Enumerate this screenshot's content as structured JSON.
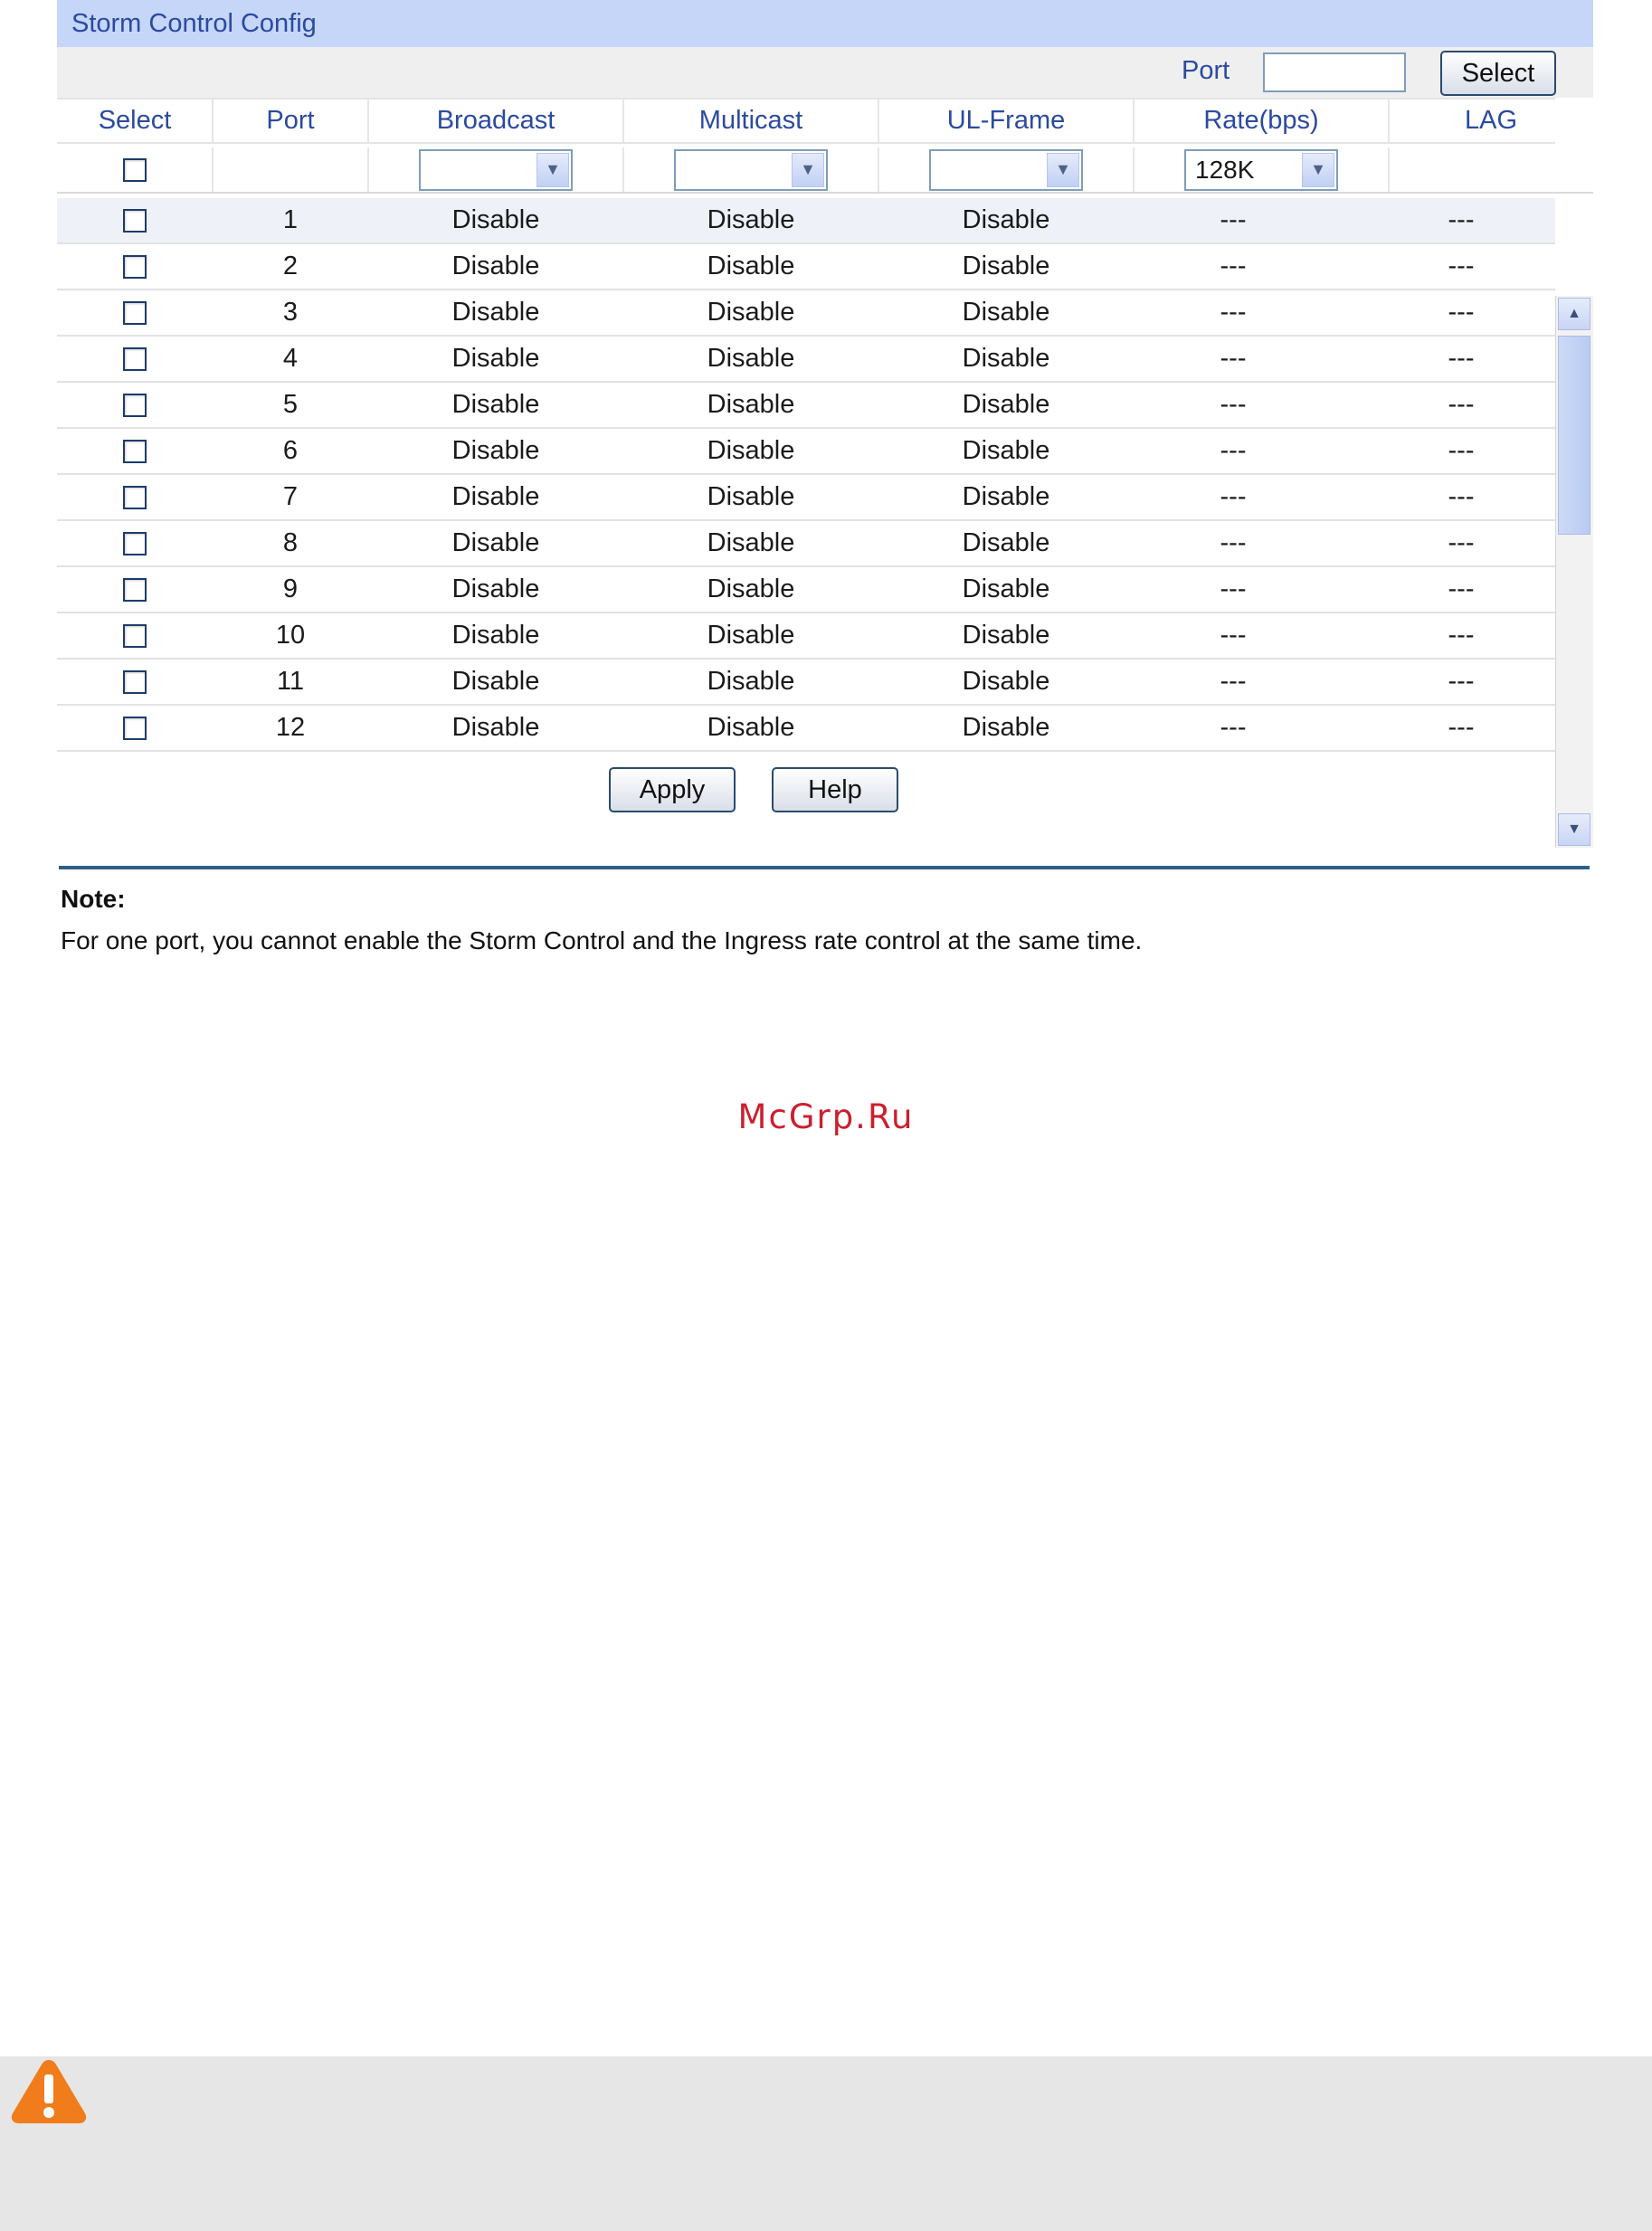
{
  "panel": {
    "title": "Storm Control Config",
    "port_label": "Port",
    "port_value": "",
    "select_button": "Select"
  },
  "table": {
    "headers": [
      "Select",
      "Port",
      "Broadcast",
      "Multicast",
      "UL-Frame",
      "Rate(bps)",
      "LAG"
    ],
    "control_row": {
      "broadcast": "",
      "multicast": "",
      "ul_frame": "",
      "rate": "128K"
    },
    "rows": [
      {
        "port": "1",
        "broadcast": "Disable",
        "multicast": "Disable",
        "ul_frame": "Disable",
        "rate": "---",
        "lag": "---"
      },
      {
        "port": "2",
        "broadcast": "Disable",
        "multicast": "Disable",
        "ul_frame": "Disable",
        "rate": "---",
        "lag": "---"
      },
      {
        "port": "3",
        "broadcast": "Disable",
        "multicast": "Disable",
        "ul_frame": "Disable",
        "rate": "---",
        "lag": "---"
      },
      {
        "port": "4",
        "broadcast": "Disable",
        "multicast": "Disable",
        "ul_frame": "Disable",
        "rate": "---",
        "lag": "---"
      },
      {
        "port": "5",
        "broadcast": "Disable",
        "multicast": "Disable",
        "ul_frame": "Disable",
        "rate": "---",
        "lag": "---"
      },
      {
        "port": "6",
        "broadcast": "Disable",
        "multicast": "Disable",
        "ul_frame": "Disable",
        "rate": "---",
        "lag": "---"
      },
      {
        "port": "7",
        "broadcast": "Disable",
        "multicast": "Disable",
        "ul_frame": "Disable",
        "rate": "---",
        "lag": "---"
      },
      {
        "port": "8",
        "broadcast": "Disable",
        "multicast": "Disable",
        "ul_frame": "Disable",
        "rate": "---",
        "lag": "---"
      },
      {
        "port": "9",
        "broadcast": "Disable",
        "multicast": "Disable",
        "ul_frame": "Disable",
        "rate": "---",
        "lag": "---"
      },
      {
        "port": "10",
        "broadcast": "Disable",
        "multicast": "Disable",
        "ul_frame": "Disable",
        "rate": "---",
        "lag": "---"
      },
      {
        "port": "11",
        "broadcast": "Disable",
        "multicast": "Disable",
        "ul_frame": "Disable",
        "rate": "---",
        "lag": "---"
      },
      {
        "port": "12",
        "broadcast": "Disable",
        "multicast": "Disable",
        "ul_frame": "Disable",
        "rate": "---",
        "lag": "---"
      }
    ]
  },
  "actions": {
    "apply": "Apply",
    "help": "Help"
  },
  "note": {
    "heading": "Note:",
    "text": "For one port, you cannot enable the Storm Control and the Ingress rate control at the same time."
  },
  "watermark": "McGrp.Ru",
  "icons": {
    "dropdown": "chevron-down-icon",
    "scroll_up": "arrow-up-icon",
    "scroll_down": "arrow-down-icon",
    "warning": "warning-icon"
  },
  "colors": {
    "title_bar": "#c5d6f8",
    "header_text": "#2b4aa0",
    "note_rule": "#2d5f8a",
    "watermark": "#cc1f2e",
    "warning": "#f07c1c"
  }
}
